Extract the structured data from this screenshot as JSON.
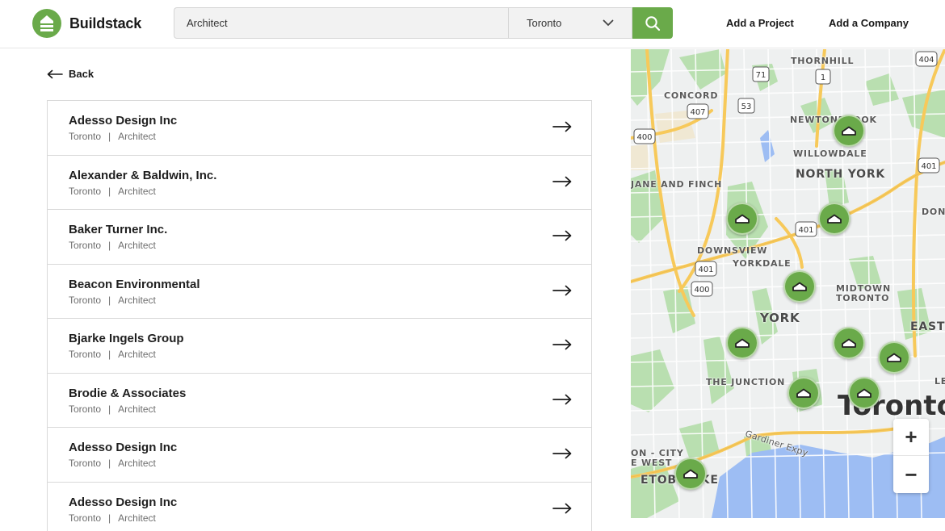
{
  "brand": {
    "name": "Buildstack",
    "color": "#6aaa4a"
  },
  "search": {
    "query": "Architect",
    "location": "Toronto"
  },
  "nav": {
    "add_project": "Add a Project",
    "add_company": "Add a Company"
  },
  "back_label": "Back",
  "results": [
    {
      "name": "Adesso Design Inc",
      "city": "Toronto",
      "separator": "|",
      "category": "Architect"
    },
    {
      "name": "Alexander & Baldwin, Inc.",
      "city": "Toronto",
      "separator": "|",
      "category": "Architect"
    },
    {
      "name": "Baker Turner Inc.",
      "city": "Toronto",
      "separator": "|",
      "category": "Architect"
    },
    {
      "name": "Beacon Environmental",
      "city": "Toronto",
      "separator": "|",
      "category": "Architect"
    },
    {
      "name": "Bjarke Ingels Group",
      "city": "Toronto",
      "separator": "|",
      "category": "Architect"
    },
    {
      "name": "Brodie & Associates",
      "city": "Toronto",
      "separator": "|",
      "category": "Architect"
    },
    {
      "name": "Adesso Design Inc",
      "city": "Toronto",
      "separator": "|",
      "category": "Architect"
    },
    {
      "name": "Adesso Design Inc",
      "city": "Toronto",
      "separator": "|",
      "category": "Architect"
    }
  ],
  "map": {
    "places": {
      "thornhill": "THORNHILL",
      "concord": "CONCORD",
      "newtonbrook": "NEWTONBROOK",
      "willowdale": "WILLOWDALE",
      "north_york": "NORTH YORK",
      "jane_finch": "JANE AND FINCH",
      "don": "DON",
      "downsview": "DOWNSVIEW",
      "yorkdale": "YORKDALE",
      "midtown": "MIDTOWN",
      "toronto_label": "TORONTO",
      "york": "YORK",
      "east": "EAST",
      "the_junction": "THE JUNCTION",
      "les": "LES",
      "toronto": "Toronto",
      "city_on": "ON - CITY",
      "e_west": "E WEST",
      "etobicoke": "ETOBICOKE",
      "gardiner": "Gardiner Expy"
    },
    "shields": {
      "s404": "404",
      "s71": "71",
      "s1": "1",
      "s407": "407",
      "s53": "53",
      "s400a": "400",
      "s401a": "401",
      "s401b": "401",
      "s401c": "401",
      "s400b": "400"
    },
    "zoom_in": "+",
    "zoom_out": "−"
  }
}
